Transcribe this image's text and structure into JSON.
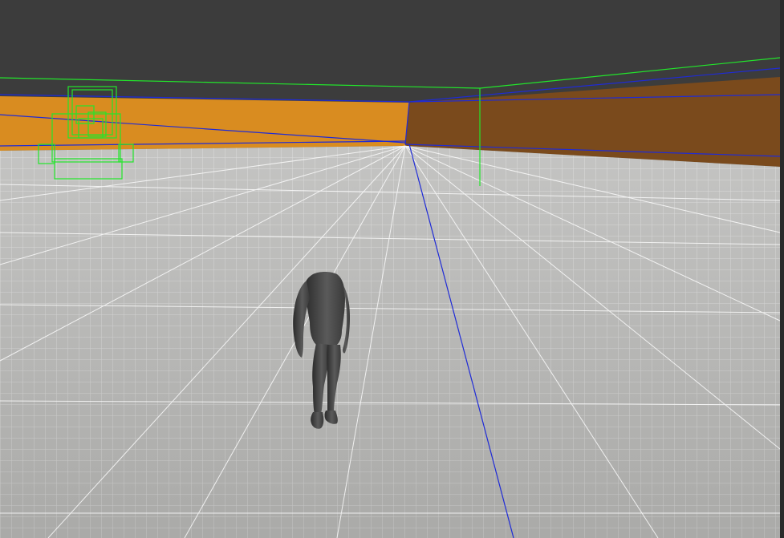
{
  "viewport": {
    "title": ""
  },
  "colors": {
    "background": "#3a3a3a",
    "ceiling": "#3c3c3c",
    "wall_left": "#d98c20",
    "wall_right": "#7a4a1c",
    "floor": "#b9b9b7",
    "grid": "#ffffff",
    "wire_blue": "#1f2bd6",
    "wire_green": "#22e62b",
    "character": "#4a4a4a",
    "right_scrollbar": "#2a2a2a"
  },
  "icons": {
    "character": "mannequin-figure",
    "helper": "wireframe-box"
  }
}
